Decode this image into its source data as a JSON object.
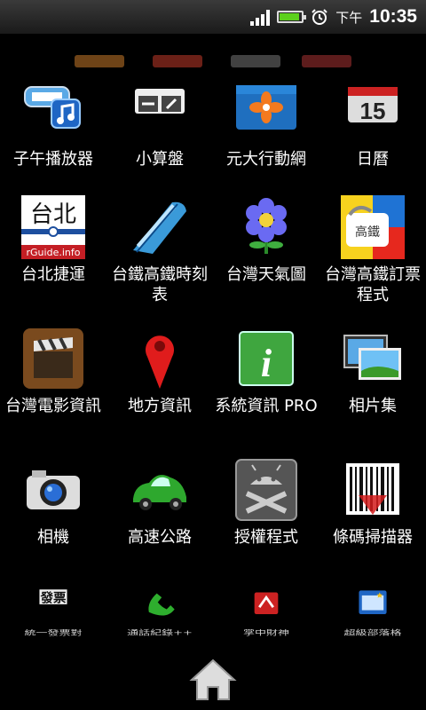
{
  "status": {
    "ampm": "下午",
    "time": "10:35",
    "icons": [
      "signal-icon",
      "battery-charging-icon",
      "alarm-icon"
    ]
  },
  "apps": [
    {
      "label": "子午播放器",
      "icon": "music-player-icon"
    },
    {
      "label": "小算盤",
      "icon": "calculator-icon"
    },
    {
      "label": "元大行動網",
      "icon": "stock-app-icon"
    },
    {
      "label": "日曆",
      "icon": "calendar-icon"
    },
    {
      "label": "台北捷運",
      "icon": "taipei-metro-icon"
    },
    {
      "label": "台鐵高鐵時刻表",
      "icon": "train-icon"
    },
    {
      "label": "台灣天氣圖",
      "icon": "weather-flower-icon"
    },
    {
      "label": "台灣高鐵訂票程式",
      "icon": "thsr-ticket-icon"
    },
    {
      "label": "台灣電影資訊",
      "icon": "movie-clapper-icon"
    },
    {
      "label": "地方資訊",
      "icon": "map-pin-icon"
    },
    {
      "label": "系統資訊 PRO",
      "icon": "system-info-icon"
    },
    {
      "label": "相片集",
      "icon": "gallery-icon"
    },
    {
      "label": "相機",
      "icon": "camera-icon"
    },
    {
      "label": "高速公路",
      "icon": "car-icon"
    },
    {
      "label": "授權程式",
      "icon": "android-license-icon"
    },
    {
      "label": "條碼掃描器",
      "icon": "barcode-scanner-icon"
    }
  ],
  "bottom_apps": [
    {
      "label": "統一發票對",
      "icon": "invoice-icon"
    },
    {
      "label": "通話紀錄++",
      "icon": "phone-icon"
    },
    {
      "label": "掌中財神",
      "icon": "finance-icon"
    },
    {
      "label": "超級部落格",
      "icon": "blog-icon"
    }
  ],
  "icon_texts": {
    "calendar_day": "15",
    "metro_logo": "台北",
    "metro_url": "rGuide.info",
    "thsr_text": "高鐵",
    "invoice_text": "發票"
  },
  "colors": {
    "background": "#000000",
    "statusbar": "#1a1a1a",
    "battery_fill": "#5cd01c"
  }
}
